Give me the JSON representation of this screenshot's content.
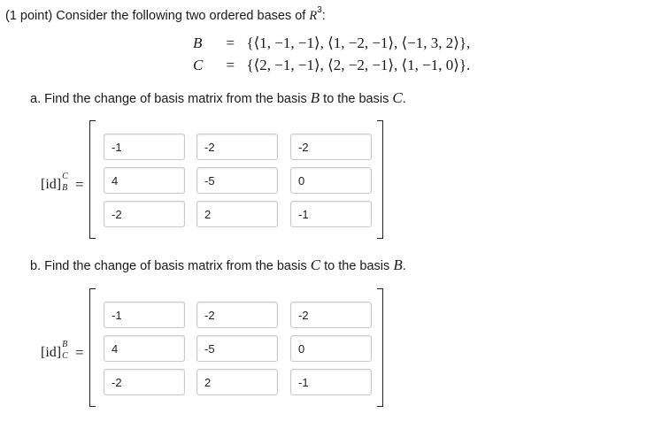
{
  "question": {
    "prefix": "(1 point) Consider the following two ordered bases of",
    "space": "R",
    "space_exp": "3",
    "colon": ":"
  },
  "bases": [
    {
      "name": "B",
      "equals": "=",
      "value": "{⟨1, −1, −1⟩, ⟨1, −2, −1⟩, ⟨−1, 3, 2⟩},"
    },
    {
      "name": "C",
      "equals": "=",
      "value": "{⟨2, −1, −1⟩, ⟨2, −2, −1⟩, ⟨1, −1, 0⟩}."
    }
  ],
  "part_a": {
    "prompt_pre": "a. Find the change of basis matrix from the basis",
    "from": "B",
    "mid": "to the basis",
    "to": "C",
    "end": ".",
    "label_main": "[id]",
    "label_sup": "C",
    "label_sub": "B",
    "equals": "=",
    "matrix": [
      [
        "-1",
        "-2",
        "-2"
      ],
      [
        "4",
        "-5",
        "0"
      ],
      [
        "-2",
        "2",
        "-1"
      ]
    ]
  },
  "part_b": {
    "prompt_pre": "b. Find the change of basis matrix from the basis",
    "from": "C",
    "mid": "to the basis",
    "to": "B",
    "end": ".",
    "label_main": "[id]",
    "label_sup": "B",
    "label_sub": "C",
    "equals": "=",
    "matrix": [
      [
        "-1",
        "-2",
        "-2"
      ],
      [
        "4",
        "-5",
        "0"
      ],
      [
        "-2",
        "2",
        "-1"
      ]
    ]
  }
}
